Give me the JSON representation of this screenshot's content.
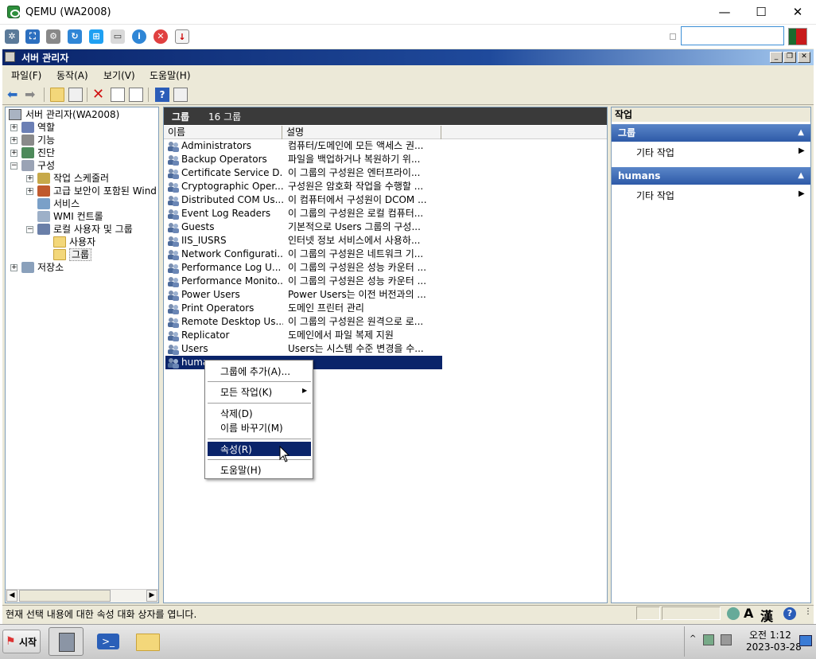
{
  "qemu": {
    "title": "QEMU (WA2008)",
    "controls": [
      "—",
      "☐",
      "✕"
    ]
  },
  "mmc": {
    "title": "서버 관리자",
    "menu": [
      "파일(F)",
      "동작(A)",
      "보기(V)",
      "도움말(H)"
    ]
  },
  "tree": {
    "root": "서버 관리자(WA2008)",
    "items": [
      {
        "label": "역할",
        "level": 1,
        "expander": "+"
      },
      {
        "label": "기능",
        "level": 1,
        "expander": "+"
      },
      {
        "label": "진단",
        "level": 1,
        "expander": "+"
      },
      {
        "label": "구성",
        "level": 1,
        "expander": "−"
      },
      {
        "label": "작업 스케줄러",
        "level": 2,
        "expander": "+"
      },
      {
        "label": "고급 보안이 포함된 Wind",
        "level": 2,
        "expander": "+"
      },
      {
        "label": "서비스",
        "level": 2,
        "expander": ""
      },
      {
        "label": "WMI 컨트롤",
        "level": 2,
        "expander": ""
      },
      {
        "label": "로컬 사용자 및 그룹",
        "level": 2,
        "expander": "−"
      },
      {
        "label": "사용자",
        "level": 3,
        "expander": ""
      },
      {
        "label": "그룹",
        "level": 3,
        "expander": "",
        "selected": true
      },
      {
        "label": "저장소",
        "level": 1,
        "expander": "+"
      }
    ]
  },
  "center": {
    "header_title": "그룹",
    "header_count": "16 그룹",
    "columns": [
      "이름",
      "설명"
    ],
    "rows": [
      {
        "name": "Administrators",
        "desc": "컴퓨터/도메인에 모든 액세스 권..."
      },
      {
        "name": "Backup Operators",
        "desc": "파일을 백업하거나 복원하기 위..."
      },
      {
        "name": "Certificate Service D...",
        "desc": "이 그룹의 구성원은 엔터프라이..."
      },
      {
        "name": "Cryptographic Oper...",
        "desc": "구성원은 암호화 작업을 수행할 ..."
      },
      {
        "name": "Distributed COM Us...",
        "desc": "이 컴퓨터에서 구성원이 DCOM ..."
      },
      {
        "name": "Event Log Readers",
        "desc": "이 그룹의 구성원은 로컬 컴퓨터..."
      },
      {
        "name": "Guests",
        "desc": "기본적으로 Users 그룹의 구성..."
      },
      {
        "name": "IIS_IUSRS",
        "desc": "인터넷 정보 서비스에서 사용하..."
      },
      {
        "name": "Network Configurati...",
        "desc": "이 그룹의 구성원은 네트워크 기..."
      },
      {
        "name": "Performance Log U...",
        "desc": "이 그룹의 구성원은 성능 카운터 ..."
      },
      {
        "name": "Performance Monito...",
        "desc": "이 그룹의 구성원은 성능 카운터 ..."
      },
      {
        "name": "Power Users",
        "desc": "Power Users는 이전 버전과의 ..."
      },
      {
        "name": "Print Operators",
        "desc": "도메인 프린터 관리"
      },
      {
        "name": "Remote Desktop Us...",
        "desc": "이 그룹의 구성원은 원격으로 로..."
      },
      {
        "name": "Replicator",
        "desc": "도메인에서 파일 복제 지원"
      },
      {
        "name": "Users",
        "desc": "Users는 시스템 수준 변경을 수..."
      },
      {
        "name": "humans",
        "desc": "",
        "selected": true
      }
    ]
  },
  "actions": {
    "title": "작업",
    "sections": [
      {
        "head": "그룹",
        "item": "기타 작업"
      },
      {
        "head": "humans",
        "item": "기타 작업"
      }
    ]
  },
  "context_menu": {
    "items": [
      "그룹에 추가(A)...",
      "모든 작업(K)",
      "삭제(D)",
      "이름 바꾸기(M)",
      "속성(R)",
      "도움말(H)"
    ],
    "highlighted": "속성(R)"
  },
  "status": {
    "text": "현재 선택 내용에 대한 속성 대화 상자를 엽니다."
  },
  "taskbar": {
    "start": "시작",
    "ime_a": "A",
    "ime_han": "漢",
    "time": "오전 1:12",
    "date": "2023-03-28"
  },
  "colors": {
    "selection": "#0a246a",
    "title_bar": "#0a246a",
    "action_head": "#2e5aa8"
  }
}
